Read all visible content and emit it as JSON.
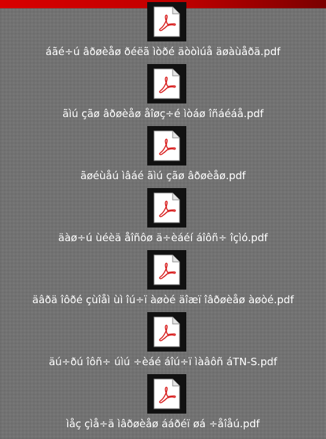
{
  "accent_bar_color": "#c00000",
  "files": [
    {
      "name": "áãé÷ú âðøèåø ðéëã ìòðé äòòìúå äøàùåðä.pdf",
      "icon": "pdf-icon"
    },
    {
      "name": "ãìú çãø âðøèåø åîøç÷é ìòáø îñáéáå.pdf",
      "icon": "pdf-icon"
    },
    {
      "name": "ãøéùåú ìâáé ãìú çãø âðøèåø.pdf",
      "icon": "pdf-icon"
    },
    {
      "name": "äàø÷ú ùéèä åîñôø ä÷èáéí áîôñ÷ îçìó.pdf",
      "icon": "pdf-icon"
    },
    {
      "name": "äâðä îôðé çùîåì ùì îú÷ï àøòé äîæï îâðøèåø àøòé.pdf",
      "icon": "pdf-icon"
    },
    {
      "name": "äú÷ðú îôñ÷ úìú ÷èáé áîú÷ï ìàâôñ áTN-S.pdf",
      "icon": "pdf-icon"
    },
    {
      "name": "ìåç çìå÷ä ìâðøèåø ááðéï øá ÷åîåú.pdf",
      "icon": "pdf-icon"
    }
  ]
}
